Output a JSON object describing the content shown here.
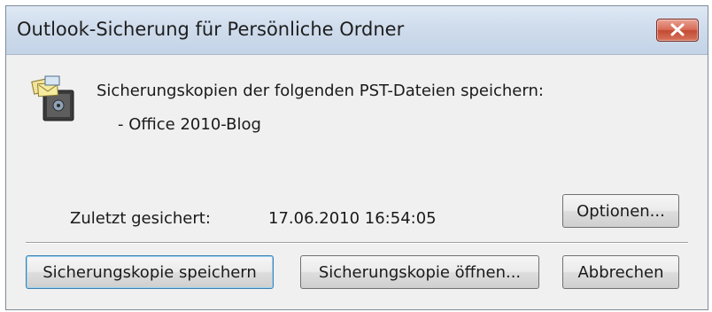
{
  "window": {
    "title": "Outlook-Sicherung für Persönliche Ordner",
    "close_icon": "close-icon"
  },
  "content": {
    "icon": "backup-safe-icon",
    "message": "Sicherungskopien der folgenden PST-Dateien speichern:",
    "files": [
      "- Office 2010-Blog"
    ],
    "last_saved_label": "Zuletzt gesichert:",
    "last_saved_value": "17.06.2010 16:54:05"
  },
  "buttons": {
    "options": "Optionen...",
    "save": "Sicherungskopie speichern",
    "open": "Sicherungskopie öffnen...",
    "cancel": "Abbrechen"
  },
  "colors": {
    "titlebar": "#cfdcec",
    "close_button": "#c24a33",
    "dialog_background": "#f0f0f0"
  }
}
